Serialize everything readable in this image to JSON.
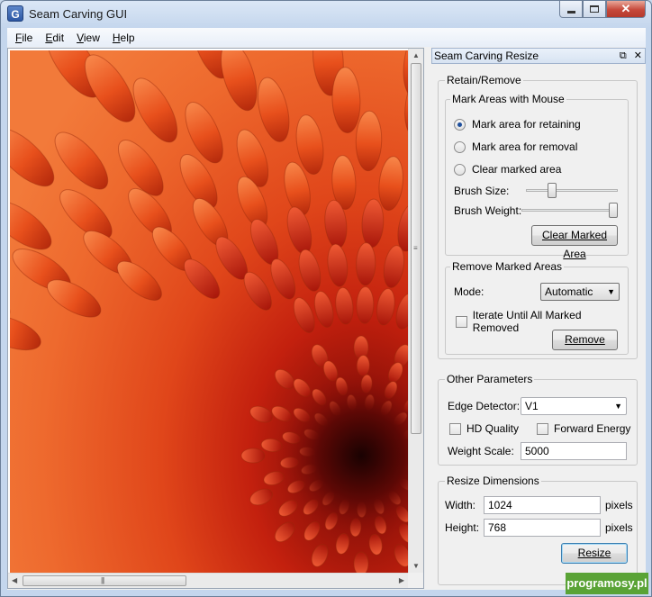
{
  "window": {
    "title": "Seam Carving GUI",
    "app_icon": "G"
  },
  "menu": [
    {
      "label": "File",
      "accel": "F",
      "rest": "ile"
    },
    {
      "label": "Edit",
      "accel": "E",
      "rest": "dit"
    },
    {
      "label": "View",
      "accel": "V",
      "rest": "iew"
    },
    {
      "label": "Help",
      "accel": "H",
      "rest": "elp"
    }
  ],
  "dock": {
    "title": "Seam Carving Resize",
    "float_icon": "⧉",
    "close_icon": "✕"
  },
  "retain_remove": {
    "legend": "Retain/Remove",
    "mark": {
      "legend": "Mark Areas with Mouse",
      "options": [
        "Mark area for retaining",
        "Mark area for removal",
        "Clear marked area"
      ],
      "selected": 0,
      "brush_size_label": "Brush Size:",
      "brush_size_level": 0.26,
      "brush_weight_label": "Brush Weight:",
      "brush_weight_level": 1.0,
      "clear_button": "Clear Marked Area"
    },
    "remove": {
      "legend": "Remove Marked Areas",
      "mode_label": "Mode:",
      "mode_value": "Automatic",
      "iterate_label": "Iterate Until All Marked Removed",
      "remove_button": "Remove"
    }
  },
  "other": {
    "legend": "Other Parameters",
    "edge_label": "Edge Detector:",
    "edge_value": "V1",
    "hd_label": "HD Quality",
    "forward_label": "Forward Energy",
    "weight_label": "Weight Scale:",
    "weight_value": "5000"
  },
  "resize": {
    "legend": "Resize Dimensions",
    "width_label": "Width:",
    "width_value": "1024",
    "height_label": "Height:",
    "height_value": "768",
    "unit": "pixels",
    "resize_button": "Resize"
  },
  "watermark": "programosy.pl",
  "colors": {
    "accent": "#1f4f9c",
    "photo_base": "#e24a12",
    "watermark": "#5aa336"
  }
}
